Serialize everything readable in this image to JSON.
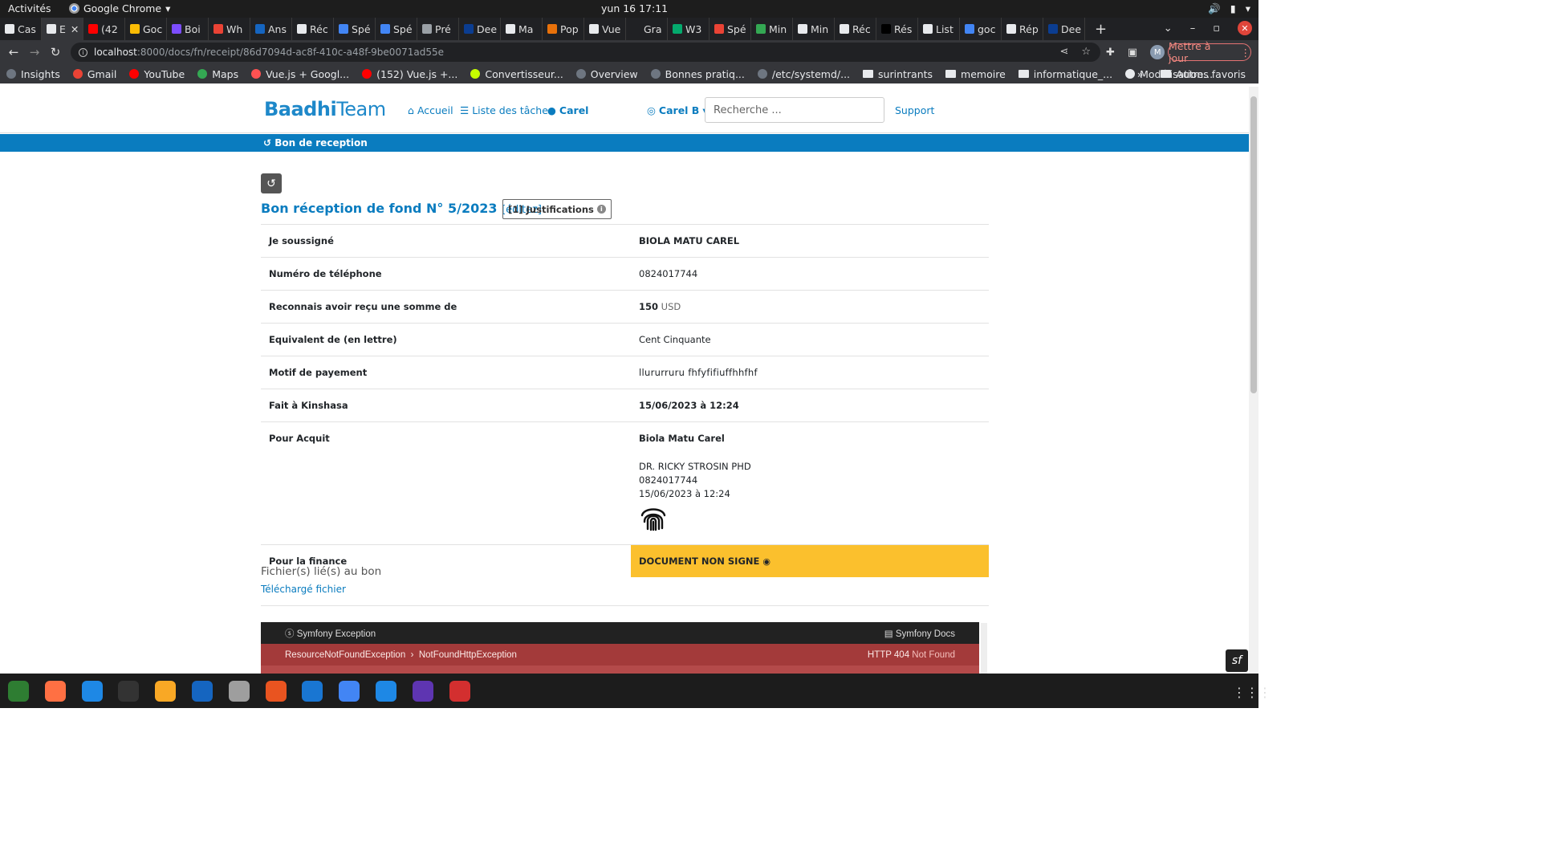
{
  "system": {
    "activities": "Activités",
    "app_name": "Google Chrome",
    "clock": "yun 16  17:11"
  },
  "tabs": [
    {
      "label": "Cas",
      "color": "#e8eaed"
    },
    {
      "label": "E",
      "color": "#e8eaed",
      "active": true
    },
    {
      "label": "(42",
      "color": "#ff0000"
    },
    {
      "label": "Goc",
      "color": "#fbbc04"
    },
    {
      "label": "Boi",
      "color": "#7c4dff"
    },
    {
      "label": "Wh",
      "color": "#ea4335"
    },
    {
      "label": "Ans",
      "color": "#1565c0"
    },
    {
      "label": "Réc",
      "color": "#e8eaed"
    },
    {
      "label": "Spé",
      "color": "#4285f4"
    },
    {
      "label": "Spé",
      "color": "#4285f4"
    },
    {
      "label": "Pré",
      "color": "#9aa0a6"
    },
    {
      "label": "Dee",
      "color": "#0b3d91"
    },
    {
      "label": "Ma",
      "color": "#e8eaed"
    },
    {
      "label": "Pop",
      "color": "#e8710a"
    },
    {
      "label": "Vue",
      "color": "#e8eaed"
    },
    {
      "label": "Gra",
      "color": "#202124"
    },
    {
      "label": "W3",
      "color": "#04aa6d"
    },
    {
      "label": "Spé",
      "color": "#ea4335"
    },
    {
      "label": "Min",
      "color": "#34a853"
    },
    {
      "label": "Min",
      "color": "#e8eaed"
    },
    {
      "label": "Réc",
      "color": "#e8eaed"
    },
    {
      "label": "Rés",
      "color": "#000000"
    },
    {
      "label": "List",
      "color": "#e8eaed"
    },
    {
      "label": "goc",
      "color": "#4285f4"
    },
    {
      "label": "Rép",
      "color": "#e8eaed"
    },
    {
      "label": "Dee",
      "color": "#0b3d91"
    }
  ],
  "address": {
    "host": "localhost",
    "path": ":8000/docs/fn/receipt/86d7094d-ac8f-410c-a48f-9be0071ad55e",
    "profile_initial": "M",
    "update_label": "Mettre à jour"
  },
  "bookmarks": [
    {
      "label": "Insights",
      "color": "#6e7681"
    },
    {
      "label": "Gmail",
      "color": "#ea4335"
    },
    {
      "label": "YouTube",
      "color": "#ff0000"
    },
    {
      "label": "Maps",
      "color": "#34a853"
    },
    {
      "label": "Vue.js + Googl...",
      "color": "#ff5252"
    },
    {
      "label": "(152) Vue.js +...",
      "color": "#ff0000"
    },
    {
      "label": "Convertisseur...",
      "color": "#c6ff00"
    },
    {
      "label": "Overview",
      "color": "#6e7681"
    },
    {
      "label": "Bonnes pratiq...",
      "color": "#6e7681"
    },
    {
      "label": "/etc/systemd/...",
      "color": "#6e7681"
    },
    {
      "label": "surintrants",
      "color": "folder"
    },
    {
      "label": "memoire",
      "color": "folder"
    },
    {
      "label": "informatique_...",
      "color": "folder"
    },
    {
      "label": "Modélisation...",
      "color": "#e8eaed"
    }
  ],
  "bookmarks_other": "Autres favoris",
  "site": {
    "logo_a": "Baadhi",
    "logo_b": "Team",
    "nav": {
      "home": "Accueil",
      "tasks": "Liste des tâches",
      "user": "Carel",
      "account": "Carel B",
      "support": "Support"
    },
    "search_placeholder": "Recherche ...",
    "subbar": "Bon de reception"
  },
  "receipt": {
    "title": "Bon réception de fond N° 5/2023",
    "edit": "[éditez]",
    "justifications": "[1] Justifications",
    "rows": {
      "undersigned_k": "Je soussigné",
      "undersigned_v": "BIOLA MATU CAREL",
      "phone_k": "Numéro de téléphone",
      "phone_v": "0824017744",
      "received_k": "Reconnais avoir reçu une somme de",
      "amount": "150",
      "currency": "USD",
      "letters_k": "Equivalent de (en lettre)",
      "letters_v": "Cent Cinquante",
      "motif_k": "Motif de payement",
      "motif_v": "llururruru fhfyfifiuffhhfhf",
      "place_k": "Fait à Kinshasa",
      "place_v": "15/06/2023 à 12:24",
      "acquit_k": "Pour Acquit",
      "acquit_name": "Biola Matu Carel",
      "signer_name": "DR. RICKY STROSIN PHD",
      "signer_phone": "0824017744",
      "signer_date": "15/06/2023 à 12:24",
      "finance_k": "Pour la finance",
      "finance_v": "DOCUMENT NON SIGNE"
    },
    "files_title": "Fichier(s) lié(s) au bon",
    "files_link": "Téléchargé fichier"
  },
  "symfony": {
    "title": "Symfony Exception",
    "docs": "Symfony Docs",
    "exc_a": "ResourceNotFoundException",
    "exc_b": "NotFoundHttpException",
    "code": "HTTP 404",
    "status": "Not Found"
  },
  "dock": [
    {
      "name": "spreadsheet",
      "color": "#2e7d32"
    },
    {
      "name": "firefox",
      "color": "#ff7043"
    },
    {
      "name": "thunderbird",
      "color": "#1e88e5"
    },
    {
      "name": "terminal",
      "color": "#333333"
    },
    {
      "name": "rhythmbox",
      "color": "#f9a825"
    },
    {
      "name": "writer",
      "color": "#1565c0"
    },
    {
      "name": "files",
      "color": "#9e9e9e"
    },
    {
      "name": "software",
      "color": "#e95420"
    },
    {
      "name": "help",
      "color": "#1976d2"
    },
    {
      "name": "chrome",
      "color": "#4285f4"
    },
    {
      "name": "vscode",
      "color": "#1e88e5"
    },
    {
      "name": "eclipse",
      "color": "#5e35b1"
    },
    {
      "name": "updater",
      "color": "#d32f2f"
    }
  ],
  "colors": {
    "brand": "#0a7cbf",
    "warning": "#fbc02d",
    "symfony_error": "#a33a3a"
  }
}
